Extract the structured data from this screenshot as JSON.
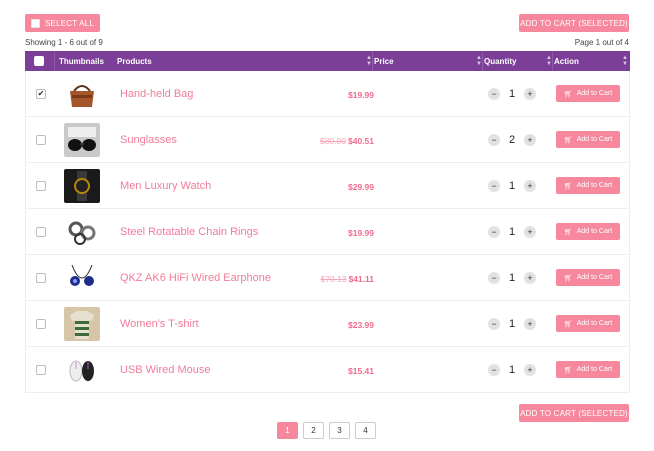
{
  "toolbar": {
    "select_all_label": "SELECT ALL",
    "add_to_cart_selected_label": "ADD TO CART (SELECTED)"
  },
  "info": {
    "showing": "Showing 1 - 6 out of 9",
    "page_of": "Page 1 out of 4"
  },
  "table": {
    "headers": {
      "thumbnails": "Thumbnails",
      "products": "Products",
      "price": "Price",
      "quantity": "Quantity",
      "action": "Action"
    },
    "rows": [
      {
        "name": "Hand-held Bag",
        "old_price": "",
        "price": "$19.99",
        "qty": "1",
        "checked": true,
        "thumb_icon": "bag-thumbnail"
      },
      {
        "name": "Sunglasses",
        "old_price": "$80.00",
        "price": "$40.51",
        "qty": "2",
        "checked": false,
        "thumb_icon": "sunglasses-thumbnail"
      },
      {
        "name": "Men Luxury Watch",
        "old_price": "",
        "price": "$29.99",
        "qty": "1",
        "checked": false,
        "thumb_icon": "watch-thumbnail"
      },
      {
        "name": "Steel Rotatable Chain Rings",
        "old_price": "",
        "price": "$19.99",
        "qty": "1",
        "checked": false,
        "thumb_icon": "rings-thumbnail"
      },
      {
        "name": "QKZ AK6 HiFi Wired Earphone",
        "old_price": "$70.13",
        "price": "$41.11",
        "qty": "1",
        "checked": false,
        "thumb_icon": "earphone-thumbnail"
      },
      {
        "name": "Women's T-shirt",
        "old_price": "",
        "price": "$23.99",
        "qty": "1",
        "checked": false,
        "thumb_icon": "tshirt-thumbnail"
      },
      {
        "name": "USB Wired Mouse",
        "old_price": "",
        "price": "$15.41",
        "qty": "1",
        "checked": false,
        "thumb_icon": "mouse-thumbnail"
      }
    ],
    "add_to_cart_label": "Add to Cart"
  },
  "pagination": {
    "pages": [
      "1",
      "2",
      "3",
      "4"
    ],
    "active": "1"
  },
  "colors": {
    "accent": "#f7879c",
    "header": "#7b3f98",
    "product_text": "#f27b99"
  }
}
